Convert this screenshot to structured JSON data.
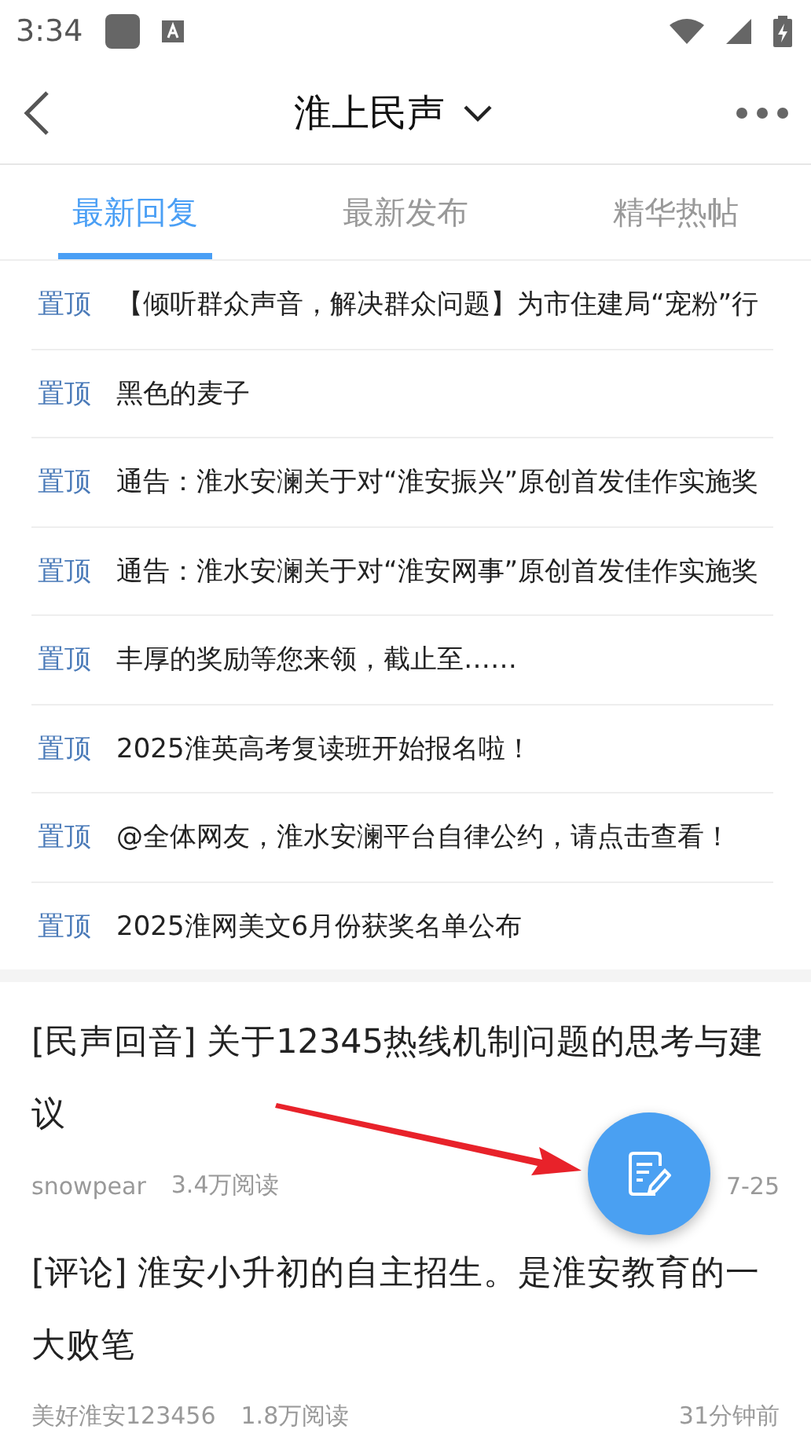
{
  "status_bar": {
    "time": "3:34"
  },
  "header": {
    "title": "淮上民声"
  },
  "tabs": [
    {
      "label": "最新回复",
      "selected": true
    },
    {
      "label": "最新发布",
      "selected": false
    },
    {
      "label": "精华热帖",
      "selected": false
    }
  ],
  "pinned": [
    {
      "tag": "置顶",
      "title": "【倾听群众声音，解决群众问题】为市住建局“宠粉”行"
    },
    {
      "tag": "置顶",
      "title": "黑色的麦子"
    },
    {
      "tag": "置顶",
      "title": "通告：淮水安澜关于对“淮安振兴”原创首发佳作实施奖"
    },
    {
      "tag": "置顶",
      "title": "通告：淮水安澜关于对“淮安网事”原创首发佳作实施奖"
    },
    {
      "tag": "置顶",
      "title": "丰厚的奖励等您来领，截止至……"
    },
    {
      "tag": "置顶",
      "title": "2025淮英高考复读班开始报名啦！"
    },
    {
      "tag": "置顶",
      "title": "@全体网友，淮水安澜平台自律公约，请点击查看！"
    },
    {
      "tag": "置顶",
      "title": "2025淮网美文6月份获奖名单公布"
    }
  ],
  "posts": [
    {
      "title": "[民声回音] 关于12345热线机制问题的思考与建议",
      "author": "snowpear",
      "reads": "3.4万阅读",
      "time": "7-25"
    },
    {
      "title": "[评论] 淮安小升初的自主招生。是淮安教育的一大败笔",
      "author": "美好淮安123456",
      "reads": "1.8万阅读",
      "time": "31分钟前"
    }
  ]
}
